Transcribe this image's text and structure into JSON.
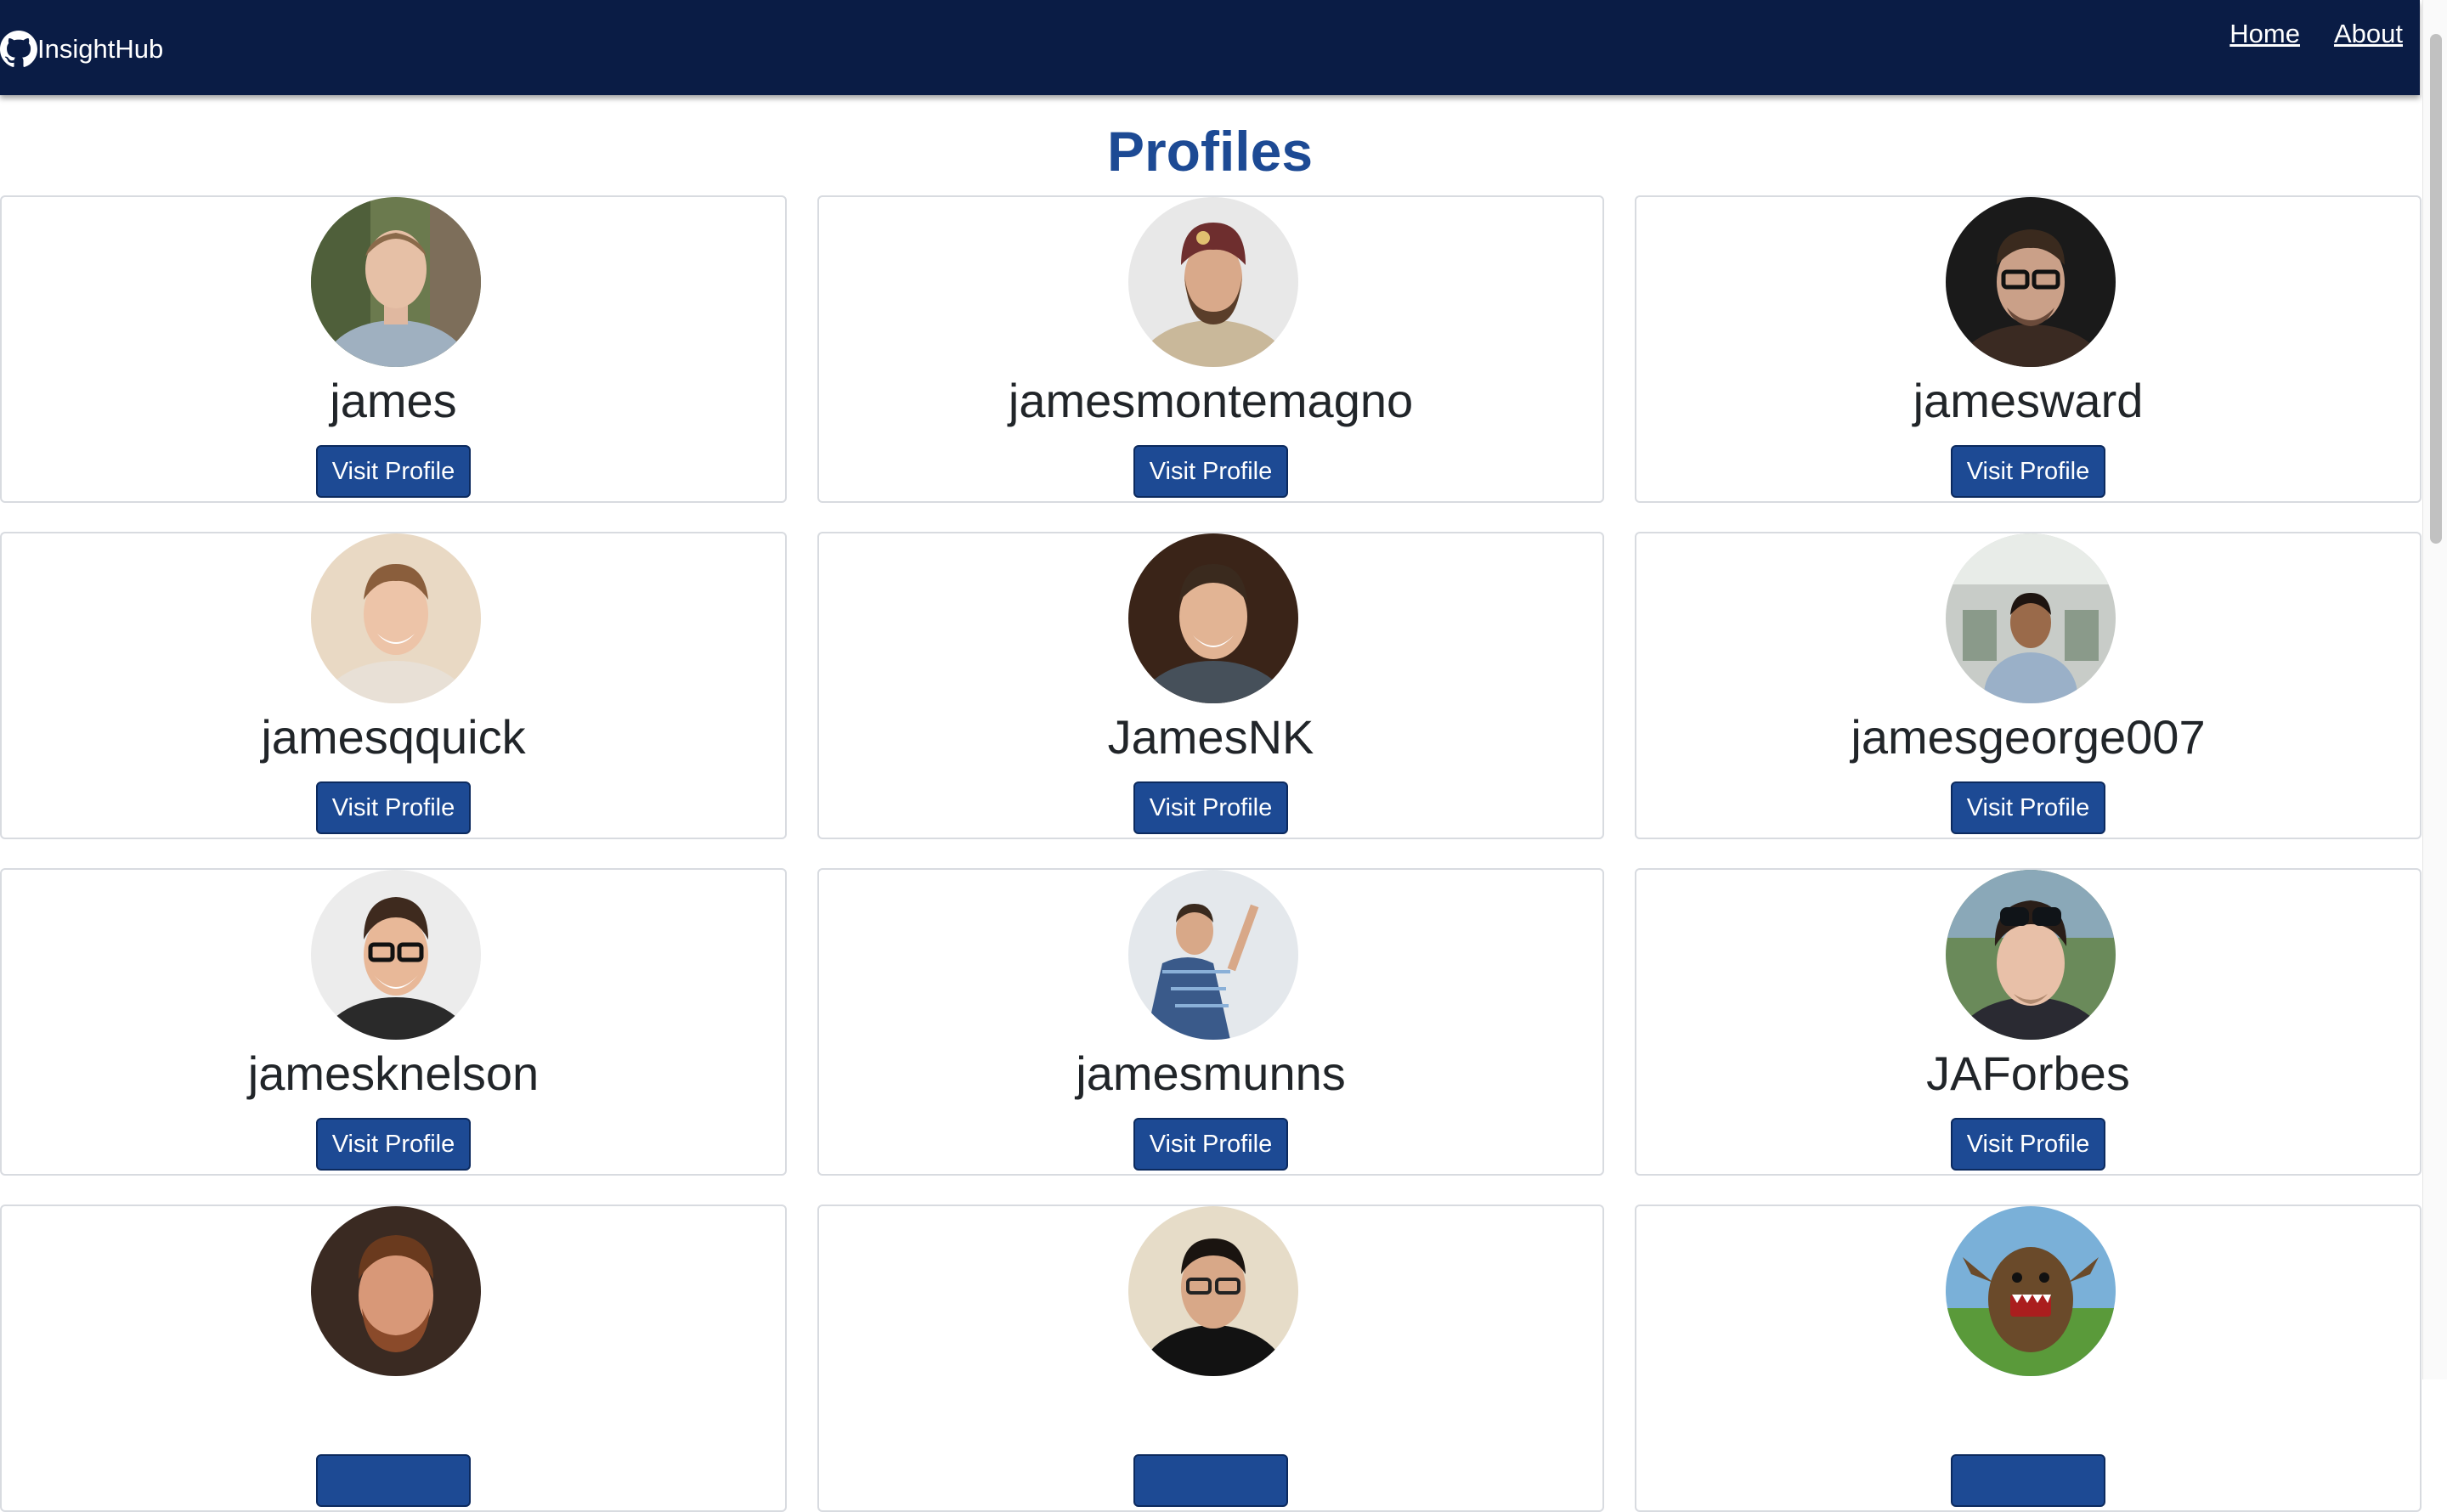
{
  "navbar": {
    "brand": "InsightHub",
    "links": [
      "Home",
      "About"
    ]
  },
  "page": {
    "title": "Profiles"
  },
  "profiles": [
    {
      "username": "james",
      "button": "Visit Profile"
    },
    {
      "username": "jamesmontemagno",
      "button": "Visit Profile"
    },
    {
      "username": "jamesward",
      "button": "Visit Profile"
    },
    {
      "username": "jamesqquick",
      "button": "Visit Profile"
    },
    {
      "username": "JamesNK",
      "button": "Visit Profile"
    },
    {
      "username": "jamesgeorge007",
      "button": "Visit Profile"
    },
    {
      "username": "jamesknelson",
      "button": "Visit Profile"
    },
    {
      "username": "jamesmunns",
      "button": "Visit Profile"
    },
    {
      "username": "JAForbes",
      "button": "Visit Profile"
    },
    {
      "username": "",
      "button": ""
    },
    {
      "username": "",
      "button": ""
    },
    {
      "username": "",
      "button": ""
    }
  ],
  "colors": {
    "navbar": "#0a1c45",
    "title": "#1d4a94",
    "button": "#1d4a94"
  },
  "icons": {
    "brand": "github-icon"
  }
}
